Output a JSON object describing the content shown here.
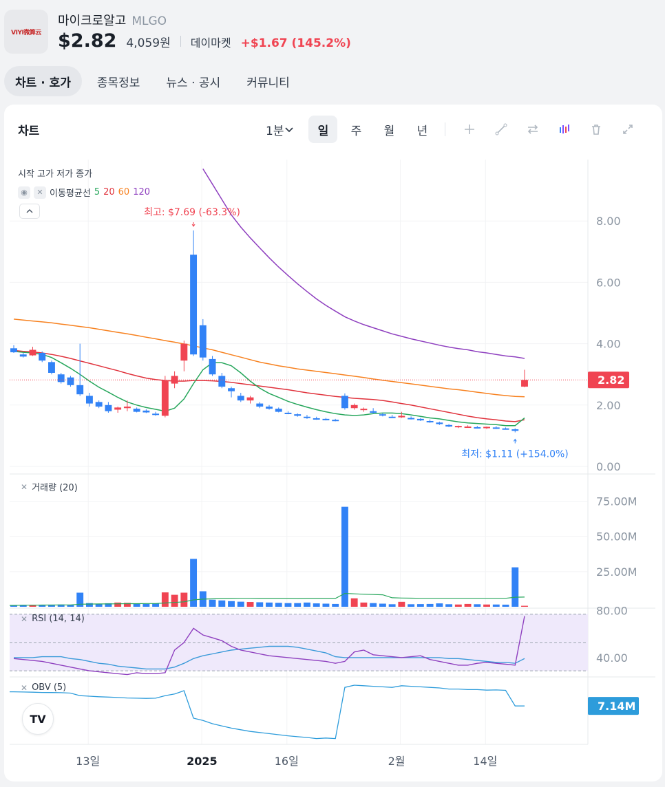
{
  "stock": {
    "name": "마이크로알고",
    "ticker": "MLGO",
    "logo_text": "VIYI微算云",
    "price": "$2.82",
    "krw": "4,059원",
    "source": "데이마켓",
    "change": "+$1.67 (145.2%)"
  },
  "tabs": [
    {
      "label": "차트 · 호가",
      "active": true
    },
    {
      "label": "종목정보"
    },
    {
      "label": "뉴스 · 공시"
    },
    {
      "label": "커뮤니티"
    }
  ],
  "chart_panel": {
    "title": "차트",
    "interval": "1분",
    "periods": [
      "일",
      "주",
      "월",
      "년"
    ],
    "active_period": "일",
    "tools": [
      "plus-icon",
      "draw-line-icon",
      "compare-icon",
      "candle-style-icon",
      "trash-icon",
      "expand-icon"
    ]
  },
  "legend": {
    "ohlc": "시작 고가 저가 종가",
    "ma_label": "이동평균선",
    "ma_periods": [
      {
        "label": "5",
        "color": "#26a65b"
      },
      {
        "label": "20",
        "color": "#e0313b"
      },
      {
        "label": "60",
        "color": "#f7811f"
      },
      {
        "label": "120",
        "color": "#8e3fbf"
      }
    ]
  },
  "annotations": {
    "high": "최고: $7.69 (-63.3%)",
    "low": "최저: $1.11 (+154.0%)"
  },
  "price_axis": {
    "ticks": [
      "8.00",
      "6.00",
      "4.00",
      "2.00",
      "0.00"
    ],
    "current": "2.82"
  },
  "volume_pane": {
    "label": "거래량 (20)",
    "ticks": [
      "75.00M",
      "50.00M",
      "25.00M"
    ]
  },
  "rsi_pane": {
    "label": "RSI (14, 14)",
    "ticks": [
      "80.00",
      "40.00"
    ]
  },
  "obv_pane": {
    "label": "OBV (5)",
    "current": "7.14M"
  },
  "x_axis": {
    "labels": [
      "13일",
      "2025",
      "16일",
      "2월",
      "14일"
    ]
  },
  "colors": {
    "up": "#f04452",
    "down": "#3182f6",
    "accent": "#f04452"
  },
  "chart_data": {
    "type": "candlestick",
    "candles": [
      [
        3.85,
        3.95,
        3.7,
        3.72
      ],
      [
        3.65,
        3.7,
        3.55,
        3.58
      ],
      [
        3.62,
        3.9,
        3.6,
        3.8
      ],
      [
        3.7,
        3.75,
        3.4,
        3.45
      ],
      [
        3.4,
        3.45,
        3.0,
        3.05
      ],
      [
        3.0,
        3.05,
        2.7,
        2.75
      ],
      [
        2.9,
        2.95,
        2.6,
        2.65
      ],
      [
        2.65,
        4.0,
        2.3,
        2.35
      ],
      [
        2.3,
        2.4,
        1.95,
        2.05
      ],
      [
        2.1,
        2.15,
        1.9,
        1.95
      ],
      [
        2.0,
        2.1,
        1.75,
        1.8
      ],
      [
        1.85,
        1.95,
        1.75,
        1.92
      ],
      [
        1.9,
        2.15,
        1.8,
        1.95
      ],
      [
        1.88,
        1.92,
        1.76,
        1.78
      ],
      [
        1.82,
        1.86,
        1.74,
        1.76
      ],
      [
        1.72,
        1.78,
        1.65,
        1.7
      ],
      [
        1.65,
        2.95,
        1.6,
        2.8
      ],
      [
        2.7,
        3.1,
        2.55,
        2.95
      ],
      [
        3.45,
        4.1,
        3.1,
        4.0
      ],
      [
        6.9,
        7.69,
        3.6,
        3.65
      ],
      [
        4.6,
        4.8,
        3.45,
        3.55
      ],
      [
        3.5,
        3.6,
        2.95,
        3.0
      ],
      [
        2.95,
        3.05,
        2.55,
        2.6
      ],
      [
        2.55,
        2.6,
        2.25,
        2.45
      ],
      [
        2.3,
        2.4,
        2.1,
        2.15
      ],
      [
        2.15,
        2.3,
        2.05,
        2.25
      ],
      [
        2.05,
        2.1,
        1.9,
        1.95
      ],
      [
        1.95,
        2.0,
        1.85,
        1.88
      ],
      [
        1.88,
        1.92,
        1.76,
        1.78
      ],
      [
        1.75,
        1.8,
        1.7,
        1.72
      ],
      [
        1.7,
        1.73,
        1.62,
        1.65
      ],
      [
        1.62,
        1.68,
        1.55,
        1.58
      ],
      [
        1.57,
        1.62,
        1.52,
        1.56
      ],
      [
        1.55,
        1.58,
        1.5,
        1.53
      ],
      [
        1.52,
        1.55,
        1.47,
        1.5
      ],
      [
        2.3,
        2.38,
        1.85,
        1.9
      ],
      [
        1.9,
        2.05,
        1.85,
        2.0
      ],
      [
        1.85,
        1.92,
        1.78,
        1.88
      ],
      [
        1.8,
        1.9,
        1.72,
        1.75
      ],
      [
        1.7,
        1.74,
        1.63,
        1.68
      ],
      [
        1.62,
        1.68,
        1.58,
        1.6
      ],
      [
        1.6,
        1.78,
        1.58,
        1.65
      ],
      [
        1.58,
        1.63,
        1.53,
        1.56
      ],
      [
        1.55,
        1.58,
        1.48,
        1.5
      ],
      [
        1.48,
        1.53,
        1.42,
        1.45
      ],
      [
        1.43,
        1.46,
        1.35,
        1.38
      ],
      [
        1.35,
        1.38,
        1.28,
        1.3
      ],
      [
        1.29,
        1.33,
        1.25,
        1.32
      ],
      [
        1.3,
        1.34,
        1.27,
        1.3
      ],
      [
        1.28,
        1.32,
        1.24,
        1.26
      ],
      [
        1.27,
        1.3,
        1.22,
        1.29
      ],
      [
        1.27,
        1.31,
        1.22,
        1.24
      ],
      [
        1.24,
        1.27,
        1.2,
        1.23
      ],
      [
        1.21,
        1.24,
        1.11,
        1.16
      ],
      [
        2.6,
        3.15,
        2.58,
        2.82
      ]
    ],
    "ma5": [
      3.75,
      3.72,
      3.7,
      3.65,
      3.55,
      3.38,
      3.2,
      3.0,
      2.78,
      2.58,
      2.42,
      2.25,
      2.1,
      2.0,
      1.92,
      1.86,
      1.8,
      1.9,
      2.2,
      2.7,
      3.15,
      3.38,
      3.38,
      3.28,
      3.05,
      2.78,
      2.55,
      2.38,
      2.25,
      2.12,
      2.02,
      1.93,
      1.85,
      1.78,
      1.72,
      1.68,
      1.66,
      1.68,
      1.72,
      1.74,
      1.74,
      1.72,
      1.68,
      1.63,
      1.58,
      1.55,
      1.5,
      1.45,
      1.42,
      1.4,
      1.38,
      1.36,
      1.33,
      1.33,
      1.58
    ],
    "ma20": [
      3.78,
      3.75,
      3.73,
      3.7,
      3.65,
      3.59,
      3.52,
      3.44,
      3.36,
      3.28,
      3.2,
      3.12,
      3.03,
      2.95,
      2.88,
      2.83,
      2.8,
      2.78,
      2.78,
      2.8,
      2.8,
      2.79,
      2.77,
      2.74,
      2.7,
      2.66,
      2.62,
      2.58,
      2.54,
      2.5,
      2.45,
      2.4,
      2.36,
      2.32,
      2.28,
      2.25,
      2.22,
      2.2,
      2.18,
      2.15,
      2.1,
      2.05,
      2.0,
      1.94,
      1.88,
      1.82,
      1.76,
      1.7,
      1.64,
      1.59,
      1.55,
      1.52,
      1.48,
      1.46,
      1.52
    ],
    "ma60": [
      4.8,
      4.77,
      4.74,
      4.71,
      4.68,
      4.64,
      4.6,
      4.56,
      4.52,
      4.47,
      4.42,
      4.37,
      4.32,
      4.27,
      4.21,
      4.16,
      4.1,
      4.05,
      3.99,
      3.93,
      3.86,
      3.8,
      3.72,
      3.64,
      3.56,
      3.48,
      3.4,
      3.34,
      3.28,
      3.23,
      3.18,
      3.14,
      3.1,
      3.06,
      3.02,
      2.98,
      2.94,
      2.9,
      2.85,
      2.81,
      2.77,
      2.73,
      2.69,
      2.65,
      2.61,
      2.57,
      2.53,
      2.5,
      2.46,
      2.42,
      2.38,
      2.34,
      2.31,
      2.28,
      2.27
    ],
    "ma120": [
      null,
      null,
      null,
      null,
      null,
      null,
      null,
      null,
      null,
      null,
      null,
      null,
      null,
      null,
      null,
      null,
      null,
      null,
      null,
      null,
      9.7,
      9.2,
      8.7,
      8.2,
      7.8,
      7.45,
      7.12,
      6.8,
      6.5,
      6.22,
      5.95,
      5.7,
      5.46,
      5.25,
      5.06,
      4.88,
      4.74,
      4.62,
      4.52,
      4.42,
      4.32,
      4.24,
      4.16,
      4.09,
      4.02,
      3.95,
      3.89,
      3.84,
      3.8,
      3.74,
      3.7,
      3.65,
      3.6,
      3.57,
      3.52
    ],
    "volume": [
      1.2,
      1.3,
      1.4,
      1.2,
      1.5,
      1.6,
      1.4,
      10.0,
      2.6,
      2.0,
      2.5,
      3.0,
      2.8,
      2.2,
      2.0,
      2.2,
      10.2,
      8.5,
      10.0,
      34.0,
      11.0,
      5.0,
      4.5,
      4.0,
      3.6,
      3.4,
      3.2,
      3.0,
      2.8,
      2.6,
      2.6,
      3.0,
      2.4,
      2.2,
      2.0,
      71.0,
      6.0,
      3.0,
      2.6,
      2.2,
      1.8,
      3.5,
      1.8,
      1.9,
      2.0,
      2.4,
      1.8,
      1.6,
      2.0,
      1.8,
      1.6,
      1.6,
      1.5,
      28.0,
      0.7
    ],
    "volume_ma20": [
      1.0,
      1.1,
      1.1,
      1.2,
      1.2,
      1.3,
      1.3,
      1.8,
      1.9,
      2.0,
      2.0,
      2.1,
      2.2,
      2.2,
      2.3,
      2.3,
      2.7,
      3.1,
      3.5,
      4.9,
      5.4,
      5.6,
      5.8,
      5.9,
      6.0,
      6.0,
      5.9,
      5.9,
      5.9,
      5.9,
      5.8,
      5.9,
      5.9,
      5.9,
      5.9,
      9.5,
      9.2,
      8.9,
      8.7,
      8.5,
      6.4,
      6.2,
      6.1,
      6.0,
      6.0,
      6.0,
      6.0,
      6.0,
      6.0,
      6.0,
      6.0,
      6.0,
      6.0,
      6.8,
      6.9
    ],
    "rsi": [
      33,
      32,
      31,
      30,
      28,
      26,
      24,
      22,
      20,
      19,
      18,
      17,
      16,
      18,
      17,
      17,
      18,
      42,
      50,
      65,
      58,
      55,
      52,
      46,
      42,
      40,
      38,
      36,
      35,
      34,
      33,
      32,
      31,
      30,
      28,
      30,
      40,
      42,
      37,
      36,
      35,
      34,
      35,
      36,
      32,
      30,
      28,
      26,
      26,
      28,
      29,
      28,
      27,
      26,
      78
    ],
    "rsi_signal": [
      34,
      34,
      34,
      35,
      35,
      35,
      33,
      32,
      30,
      28,
      27,
      25,
      24,
      23,
      22,
      22,
      22,
      24,
      28,
      33,
      36,
      38,
      40,
      42,
      43,
      44,
      45,
      46,
      46,
      46,
      45,
      43,
      41,
      39,
      35,
      34,
      34,
      34,
      34,
      34,
      34,
      34,
      34,
      34,
      34,
      34,
      33,
      33,
      32,
      31,
      30,
      29,
      29,
      28,
      33
    ],
    "obv": [
      20,
      19.8,
      19.6,
      19.4,
      19.3,
      19.2,
      18.8,
      16.5,
      16.0,
      15.5,
      15.2,
      14.8,
      14.4,
      14.2,
      14.0,
      14.2,
      16.5,
      18.0,
      21.0,
      -4.0,
      -6.0,
      -9.0,
      -11.0,
      -13.0,
      -14.5,
      -16.0,
      -17.0,
      -18.0,
      -19.0,
      -20.0,
      -20.8,
      -21.5,
      -22.5,
      -22.0,
      -22.5,
      24.0,
      26.0,
      25.5,
      25.0,
      24.5,
      24.0,
      25.5,
      25.0,
      24.5,
      24.0,
      23.5,
      22.5,
      22.5,
      22.0,
      22.0,
      21.5,
      21.7,
      21.3,
      7.14,
      7.14
    ],
    "high_label": "최고: $7.69 (-63.3%)",
    "low_label": "최저: $1.11 (+154.0%)",
    "ylim": [
      0,
      10
    ],
    "price_ticks": [
      8,
      6,
      4,
      2,
      0
    ],
    "volume_ylim": [
      0,
      85
    ],
    "rsi_ylim": [
      15,
      85
    ],
    "rsi_bands": [
      30,
      70
    ]
  }
}
